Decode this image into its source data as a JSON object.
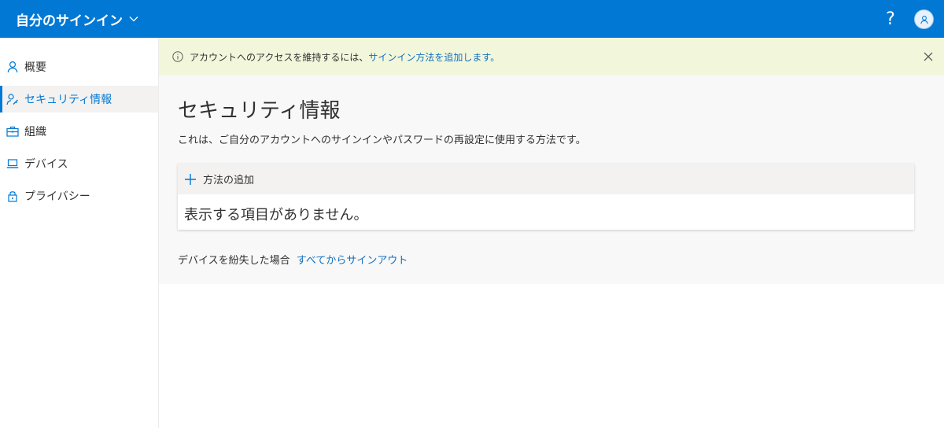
{
  "header": {
    "app_title": "自分のサインイン",
    "help_label": "?",
    "accent_color": "#0078d4"
  },
  "sidebar": {
    "items": [
      {
        "label": "概要",
        "icon": "person-icon",
        "active": false
      },
      {
        "label": "セキュリティ情報",
        "icon": "person-key-icon",
        "active": true
      },
      {
        "label": "組織",
        "icon": "briefcase-icon",
        "active": false
      },
      {
        "label": "デバイス",
        "icon": "laptop-icon",
        "active": false
      },
      {
        "label": "プライバシー",
        "icon": "lock-icon",
        "active": false
      }
    ]
  },
  "banner": {
    "text": "アカウントへのアクセスを維持するには、",
    "link_text": "サインイン方法を追加します。",
    "background": "#f2f7dc"
  },
  "main": {
    "title": "セキュリティ情報",
    "description": "これは、ご自分のアカウントへのサインインやパスワードの再設定に使用する方法です。",
    "add_method_label": "方法の追加",
    "empty_text": "表示する項目がありません。",
    "lost_device_text": "デバイスを紛失した場合",
    "sign_out_everywhere_link": "すべてからサインアウト"
  }
}
